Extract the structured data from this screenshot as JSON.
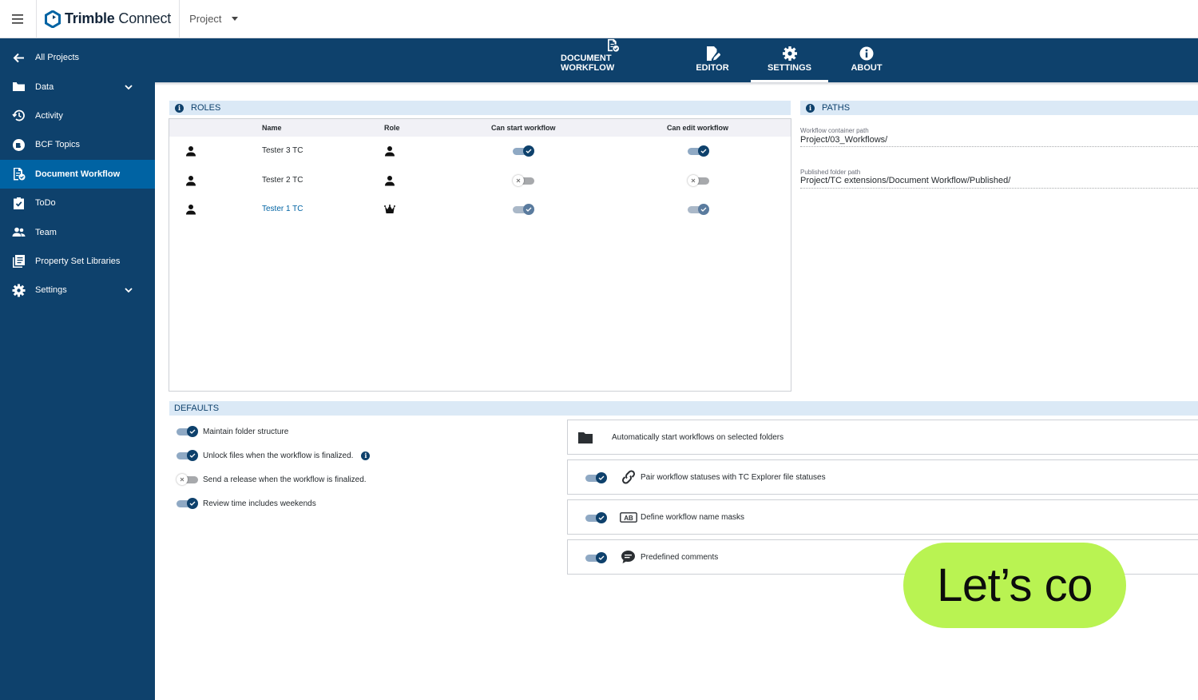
{
  "app": {
    "brand_main": "Trimble",
    "brand_sub": " Connect",
    "project_selector": "Project"
  },
  "sidebar": {
    "items": [
      {
        "label": "All Projects",
        "icon": "arrow-left-icon"
      },
      {
        "label": "Data",
        "icon": "folder-icon",
        "expandable": true
      },
      {
        "label": "Activity",
        "icon": "history-icon"
      },
      {
        "label": "BCF Topics",
        "icon": "bcf-icon"
      },
      {
        "label": "Document Workflow",
        "icon": "document-workflow-icon",
        "active": true
      },
      {
        "label": "ToDo",
        "icon": "clipboard-check-icon"
      },
      {
        "label": "Team",
        "icon": "team-icon"
      },
      {
        "label": "Property Set Libraries",
        "icon": "library-icon"
      },
      {
        "label": "Settings",
        "icon": "gear-icon",
        "expandable": true
      }
    ]
  },
  "tabs": [
    {
      "label": "DOCUMENT WORKFLOW",
      "icon": "document-workflow-icon"
    },
    {
      "label": "EDITOR",
      "icon": "edit-document-icon"
    },
    {
      "label": "SETTINGS",
      "icon": "gear-icon",
      "active": true
    },
    {
      "label": "ABOUT",
      "icon": "info-icon"
    }
  ],
  "roles": {
    "title": "ROLES",
    "columns": {
      "name": "Name",
      "role": "Role",
      "can_start": "Can start workflow",
      "can_edit": "Can edit workflow"
    },
    "rows": [
      {
        "name": "Tester 3 TC",
        "role": "member",
        "can_start": true,
        "can_edit": true,
        "highlight": false
      },
      {
        "name": "Tester 2 TC",
        "role": "member",
        "can_start": false,
        "can_edit": false,
        "highlight": false
      },
      {
        "name": "Tester 1 TC",
        "role": "owner",
        "can_start": true,
        "can_edit": true,
        "highlight": true
      }
    ]
  },
  "paths": {
    "title": "PATHS",
    "container_label": "Workflow container path",
    "container_value": "Project/03_Workflows/",
    "published_label": "Published folder path",
    "published_value": "Project/TC extensions/Document Workflow/Published/"
  },
  "defaults": {
    "title": "DEFAULTS",
    "options": [
      {
        "label": "Maintain folder structure",
        "on": true
      },
      {
        "label": "Unlock files when the workflow is finalized.",
        "on": true,
        "info": true
      },
      {
        "label": "Send a release when the workflow is finalized.",
        "on": false
      },
      {
        "label": "Review time includes weekends",
        "on": true
      }
    ],
    "cards": [
      {
        "label": "Automatically start workflows on selected folders",
        "icon": "folder-icon",
        "toggle": null
      },
      {
        "label": "Pair workflow statuses with TC Explorer file statuses",
        "icon": "link-icon",
        "toggle": true
      },
      {
        "label": "Define workflow name masks",
        "icon": "ab-mask-icon",
        "toggle": true
      },
      {
        "label": "Predefined comments",
        "icon": "comment-icon",
        "toggle": true
      }
    ]
  },
  "cta": {
    "text": "Let’s co"
  },
  "colors": {
    "navy": "#0e416c",
    "active_blue": "#0063a3",
    "section_bg": "#dbe9f6",
    "cta_green": "#b9f352",
    "link_blue": "#0063a3"
  }
}
